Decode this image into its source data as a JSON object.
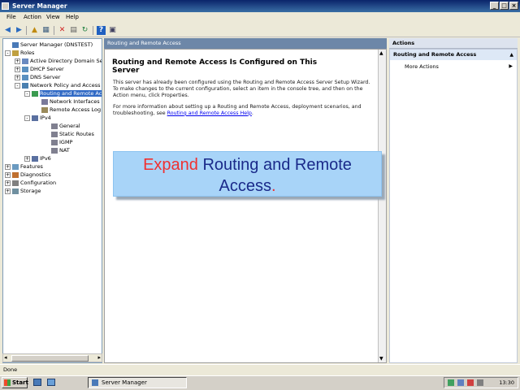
{
  "window": {
    "title": "Server Manager"
  },
  "menu": [
    "File",
    "Action",
    "View",
    "Help"
  ],
  "tree": [
    {
      "label": "Server Manager (DNSTEST)",
      "exp": "",
      "icon": "server-icon"
    },
    {
      "label": "Roles",
      "exp": "-",
      "icon": "folder-icon"
    },
    {
      "label": "Active Directory Domain Se",
      "exp": "+",
      "icon": "directory-icon"
    },
    {
      "label": "DHCP Server",
      "exp": "+",
      "icon": "dhcp-icon"
    },
    {
      "label": "DNS Server",
      "exp": "+",
      "icon": "dns-icon"
    },
    {
      "label": "Network Policy and Access",
      "exp": "-",
      "icon": "network-icon"
    },
    {
      "label": "Routing and Remote Ac",
      "exp": "-",
      "icon": "routing-icon",
      "selected": true
    },
    {
      "label": "Network Interfaces",
      "exp": "",
      "icon": "interfaces-icon"
    },
    {
      "label": "Remote Access Log",
      "exp": "",
      "icon": "log-icon"
    },
    {
      "label": "IPv4",
      "exp": "-",
      "icon": "ipv4-icon"
    },
    {
      "label": "General",
      "exp": "",
      "icon": "general-icon"
    },
    {
      "label": "Static Routes",
      "exp": "",
      "icon": "static-routes-icon"
    },
    {
      "label": "IGMP",
      "exp": "",
      "icon": "igmp-icon"
    },
    {
      "label": "NAT",
      "exp": "",
      "icon": "nat-icon"
    },
    {
      "label": "IPv6",
      "exp": "+",
      "icon": "ipv6-icon"
    },
    {
      "label": "Features",
      "exp": "+",
      "icon": "features-icon"
    },
    {
      "label": "Diagnostics",
      "exp": "+",
      "icon": "diagnostics-icon"
    },
    {
      "label": "Configuration",
      "exp": "+",
      "icon": "configuration-icon"
    },
    {
      "label": "Storage",
      "exp": "+",
      "icon": "storage-icon"
    }
  ],
  "center": {
    "header": "Routing and Remote Access",
    "title": "Routing and Remote Access Is Configured on This Server",
    "para1": "This server has already been configured using the Routing and Remote Access Server Setup Wizard. To make changes to the current configuration, select an item in the console tree, and then on the Action menu, click Properties.",
    "para2": "For more information about setting up a Routing and Remote Access, deployment scenarios, and troubleshooting, see",
    "link": "Routing and Remote Access Help",
    "para2_end": "."
  },
  "overlay": {
    "highlight": "Expand",
    "rest": " Routing and Remote Access",
    "dot": "."
  },
  "actions": {
    "header": "Actions",
    "section": "Routing and Remote Access",
    "more": "More Actions"
  },
  "status": "Done",
  "taskbar": {
    "start": "Start",
    "item": "Server Manager",
    "clock": "13:30"
  }
}
